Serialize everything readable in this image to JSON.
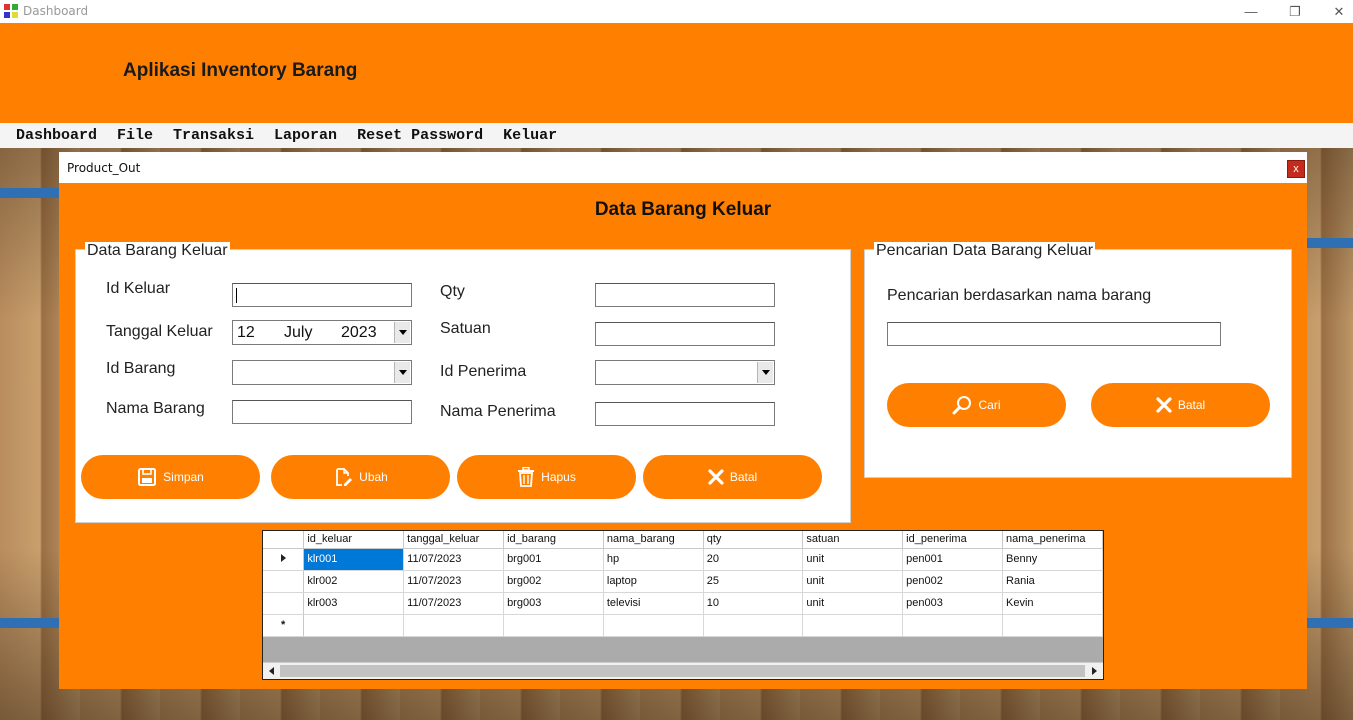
{
  "window": {
    "title": "Dashboard",
    "controls": {
      "minimize": "—",
      "maximize": "❐",
      "close": "✕"
    }
  },
  "header": {
    "title": "Aplikasi Inventory Barang"
  },
  "menu": [
    "Dashboard",
    "File",
    "Transaksi",
    "Laporan",
    "Reset Password",
    "Keluar"
  ],
  "child_form": {
    "title": "Product_Out",
    "close": "x",
    "heading": "Data Barang Keluar",
    "entry_group": {
      "legend": "Data Barang Keluar",
      "labels": {
        "id_keluar": "Id Keluar",
        "tanggal_keluar": "Tanggal Keluar",
        "id_barang": "Id Barang",
        "nama_barang": "Nama Barang",
        "qty": "Qty",
        "satuan": "Satuan",
        "id_penerima": "Id Penerima",
        "nama_penerima": "Nama Penerima"
      },
      "values": {
        "id_keluar": "",
        "date_day": "12",
        "date_month": "July",
        "date_year": "2023",
        "id_barang": "",
        "nama_barang": "",
        "qty": "",
        "satuan": "",
        "id_penerima": "",
        "nama_penerima": ""
      },
      "buttons": {
        "simpan": "Simpan",
        "ubah": "Ubah",
        "hapus": "Hapus",
        "batal": "Batal"
      }
    },
    "search_group": {
      "legend": "Pencarian Data Barang Keluar",
      "label": "Pencarian berdasarkan nama barang",
      "value": "",
      "buttons": {
        "cari": "Cari",
        "batal": "Batal"
      }
    },
    "grid": {
      "columns": [
        "id_keluar",
        "tanggal_keluar",
        "id_barang",
        "nama_barang",
        "qty",
        "satuan",
        "id_penerima",
        "nama_penerima"
      ],
      "rows": [
        [
          "klr001",
          "11/07/2023",
          "brg001",
          "hp",
          "20",
          "unit",
          "pen001",
          "Benny"
        ],
        [
          "klr002",
          "11/07/2023",
          "brg002",
          "laptop",
          "25",
          "unit",
          "pen002",
          "Rania"
        ],
        [
          "klr003",
          "11/07/2023",
          "brg003",
          "televisi",
          "10",
          "unit",
          "pen003",
          "Kevin"
        ]
      ],
      "new_row_marker": "*"
    }
  },
  "colors": {
    "accent": "#FF8000",
    "selection": "#0078d7"
  }
}
